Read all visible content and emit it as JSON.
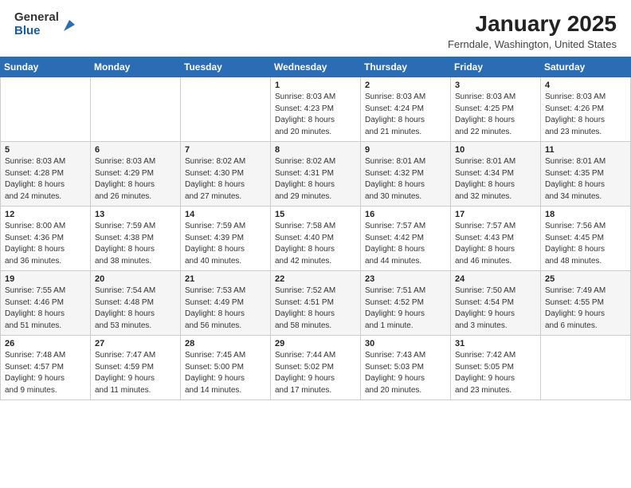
{
  "header": {
    "logo_general": "General",
    "logo_blue": "Blue",
    "month": "January 2025",
    "location": "Ferndale, Washington, United States"
  },
  "weekdays": [
    "Sunday",
    "Monday",
    "Tuesday",
    "Wednesday",
    "Thursday",
    "Friday",
    "Saturday"
  ],
  "weeks": [
    [
      {
        "day": "",
        "info": ""
      },
      {
        "day": "",
        "info": ""
      },
      {
        "day": "",
        "info": ""
      },
      {
        "day": "1",
        "info": "Sunrise: 8:03 AM\nSunset: 4:23 PM\nDaylight: 8 hours\nand 20 minutes."
      },
      {
        "day": "2",
        "info": "Sunrise: 8:03 AM\nSunset: 4:24 PM\nDaylight: 8 hours\nand 21 minutes."
      },
      {
        "day": "3",
        "info": "Sunrise: 8:03 AM\nSunset: 4:25 PM\nDaylight: 8 hours\nand 22 minutes."
      },
      {
        "day": "4",
        "info": "Sunrise: 8:03 AM\nSunset: 4:26 PM\nDaylight: 8 hours\nand 23 minutes."
      }
    ],
    [
      {
        "day": "5",
        "info": "Sunrise: 8:03 AM\nSunset: 4:28 PM\nDaylight: 8 hours\nand 24 minutes."
      },
      {
        "day": "6",
        "info": "Sunrise: 8:03 AM\nSunset: 4:29 PM\nDaylight: 8 hours\nand 26 minutes."
      },
      {
        "day": "7",
        "info": "Sunrise: 8:02 AM\nSunset: 4:30 PM\nDaylight: 8 hours\nand 27 minutes."
      },
      {
        "day": "8",
        "info": "Sunrise: 8:02 AM\nSunset: 4:31 PM\nDaylight: 8 hours\nand 29 minutes."
      },
      {
        "day": "9",
        "info": "Sunrise: 8:01 AM\nSunset: 4:32 PM\nDaylight: 8 hours\nand 30 minutes."
      },
      {
        "day": "10",
        "info": "Sunrise: 8:01 AM\nSunset: 4:34 PM\nDaylight: 8 hours\nand 32 minutes."
      },
      {
        "day": "11",
        "info": "Sunrise: 8:01 AM\nSunset: 4:35 PM\nDaylight: 8 hours\nand 34 minutes."
      }
    ],
    [
      {
        "day": "12",
        "info": "Sunrise: 8:00 AM\nSunset: 4:36 PM\nDaylight: 8 hours\nand 36 minutes."
      },
      {
        "day": "13",
        "info": "Sunrise: 7:59 AM\nSunset: 4:38 PM\nDaylight: 8 hours\nand 38 minutes."
      },
      {
        "day": "14",
        "info": "Sunrise: 7:59 AM\nSunset: 4:39 PM\nDaylight: 8 hours\nand 40 minutes."
      },
      {
        "day": "15",
        "info": "Sunrise: 7:58 AM\nSunset: 4:40 PM\nDaylight: 8 hours\nand 42 minutes."
      },
      {
        "day": "16",
        "info": "Sunrise: 7:57 AM\nSunset: 4:42 PM\nDaylight: 8 hours\nand 44 minutes."
      },
      {
        "day": "17",
        "info": "Sunrise: 7:57 AM\nSunset: 4:43 PM\nDaylight: 8 hours\nand 46 minutes."
      },
      {
        "day": "18",
        "info": "Sunrise: 7:56 AM\nSunset: 4:45 PM\nDaylight: 8 hours\nand 48 minutes."
      }
    ],
    [
      {
        "day": "19",
        "info": "Sunrise: 7:55 AM\nSunset: 4:46 PM\nDaylight: 8 hours\nand 51 minutes."
      },
      {
        "day": "20",
        "info": "Sunrise: 7:54 AM\nSunset: 4:48 PM\nDaylight: 8 hours\nand 53 minutes."
      },
      {
        "day": "21",
        "info": "Sunrise: 7:53 AM\nSunset: 4:49 PM\nDaylight: 8 hours\nand 56 minutes."
      },
      {
        "day": "22",
        "info": "Sunrise: 7:52 AM\nSunset: 4:51 PM\nDaylight: 8 hours\nand 58 minutes."
      },
      {
        "day": "23",
        "info": "Sunrise: 7:51 AM\nSunset: 4:52 PM\nDaylight: 9 hours\nand 1 minute."
      },
      {
        "day": "24",
        "info": "Sunrise: 7:50 AM\nSunset: 4:54 PM\nDaylight: 9 hours\nand 3 minutes."
      },
      {
        "day": "25",
        "info": "Sunrise: 7:49 AM\nSunset: 4:55 PM\nDaylight: 9 hours\nand 6 minutes."
      }
    ],
    [
      {
        "day": "26",
        "info": "Sunrise: 7:48 AM\nSunset: 4:57 PM\nDaylight: 9 hours\nand 9 minutes."
      },
      {
        "day": "27",
        "info": "Sunrise: 7:47 AM\nSunset: 4:59 PM\nDaylight: 9 hours\nand 11 minutes."
      },
      {
        "day": "28",
        "info": "Sunrise: 7:45 AM\nSunset: 5:00 PM\nDaylight: 9 hours\nand 14 minutes."
      },
      {
        "day": "29",
        "info": "Sunrise: 7:44 AM\nSunset: 5:02 PM\nDaylight: 9 hours\nand 17 minutes."
      },
      {
        "day": "30",
        "info": "Sunrise: 7:43 AM\nSunset: 5:03 PM\nDaylight: 9 hours\nand 20 minutes."
      },
      {
        "day": "31",
        "info": "Sunrise: 7:42 AM\nSunset: 5:05 PM\nDaylight: 9 hours\nand 23 minutes."
      },
      {
        "day": "",
        "info": ""
      }
    ]
  ]
}
